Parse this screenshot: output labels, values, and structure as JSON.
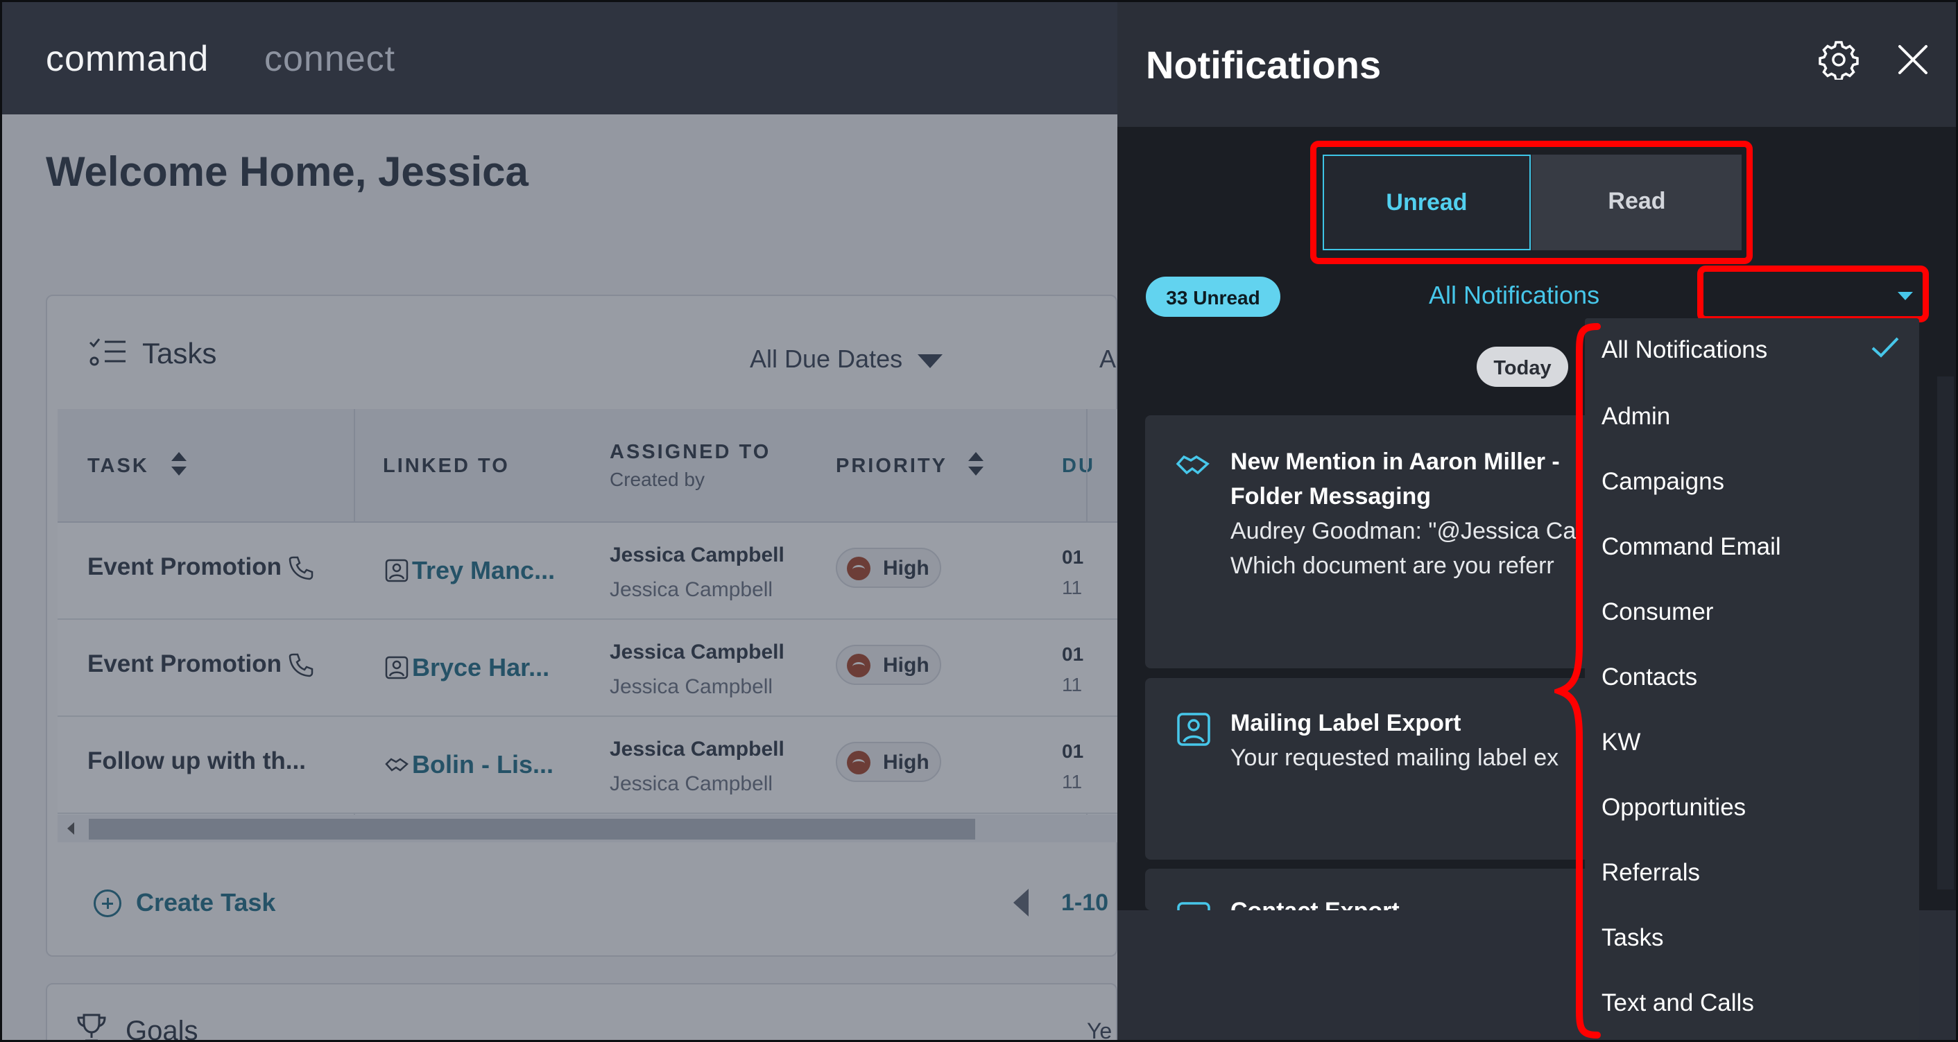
{
  "app": {
    "brand_primary": "command",
    "brand_secondary": "connect",
    "welcome": "Welcome Home, Jessica"
  },
  "tasks": {
    "title": "Tasks",
    "due_filter": "All Due Dates",
    "due_filter_cut": "A",
    "columns": {
      "task": "TASK",
      "linked_to": "LINKED TO",
      "assigned_to": "ASSIGNED TO",
      "created_by": "Created by",
      "priority": "PRIORITY",
      "due": "DU"
    },
    "rows": [
      {
        "task": "Event Promotion",
        "linked": "Trey Manc...",
        "assignee": "Jessica Campbell",
        "creator": "Jessica Campbell",
        "priority": "High",
        "due1": "01",
        "due2": "11"
      },
      {
        "task": "Event Promotion",
        "linked": "Bryce Har...",
        "assignee": "Jessica Campbell",
        "creator": "Jessica Campbell",
        "priority": "High",
        "due1": "01",
        "due2": "11"
      },
      {
        "task": "Follow up with th...",
        "linked": "Bolin - Lis...",
        "assignee": "Jessica Campbell",
        "creator": "Jessica Campbell",
        "priority": "High",
        "due1": "01",
        "due2": "11"
      }
    ],
    "create_task": "Create Task",
    "pagination": "1-10"
  },
  "goals": {
    "title": "Goals",
    "cut_label": "Ye"
  },
  "notifications": {
    "title": "Notifications",
    "tabs": {
      "unread": "Unread",
      "read": "Read"
    },
    "unread_badge": "33 Unread",
    "filter_label": "All Notifications",
    "date_group": "Today",
    "items": [
      {
        "title_line1": "New Mention in Aaron Miller -",
        "title_line2": "Folder Messaging",
        "body_line1": "Audrey Goodman: \"@Jessica Ca",
        "body_line2": "Which document are you referr"
      },
      {
        "title_line1": "Mailing Label Export",
        "body_line1": "Your requested mailing label ex"
      },
      {
        "title_line1": "Contact Export"
      }
    ],
    "filter_options": [
      "All Notifications",
      "Admin",
      "Campaigns",
      "Command Email",
      "Consumer",
      "Contacts",
      "KW",
      "Opportunities",
      "Referrals",
      "Tasks",
      "Text and Calls"
    ]
  },
  "colors": {
    "accent": "#47c7ea",
    "highlight": "#ff0000",
    "panel_bg": "#1b1e24",
    "priority_high": "#a8452b"
  }
}
